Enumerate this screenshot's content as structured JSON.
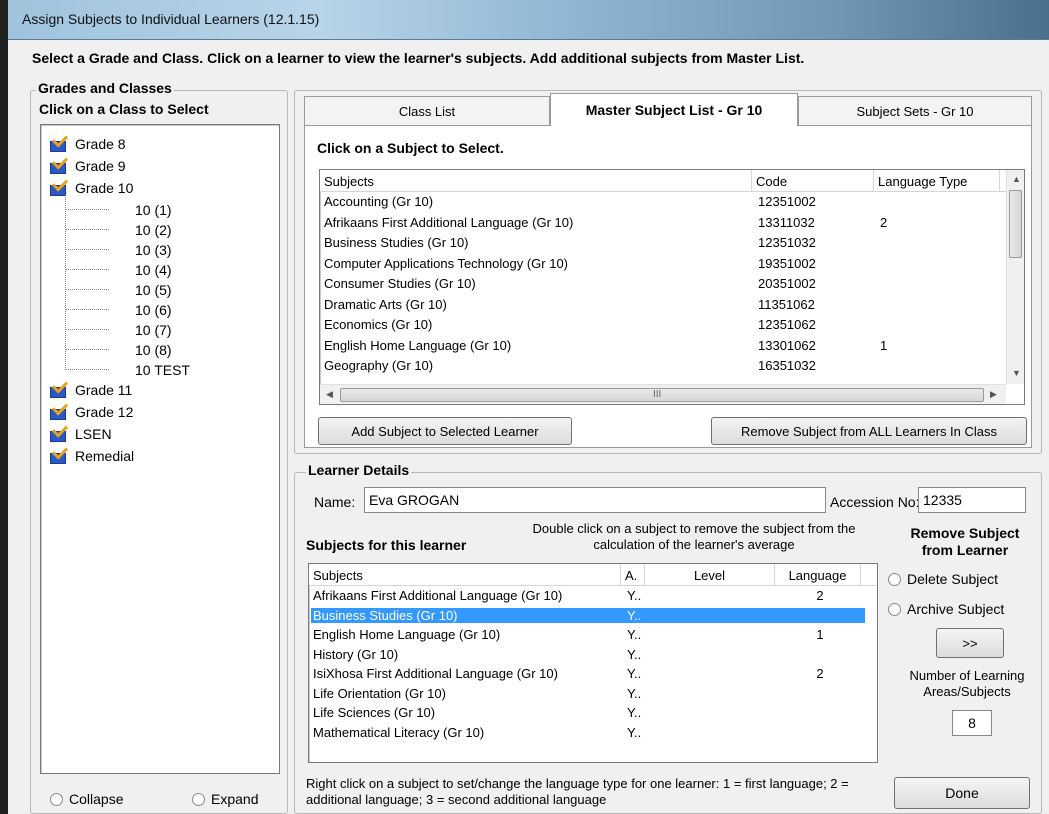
{
  "window": {
    "title": "Assign Subjects to Individual Learners (12.1.15)"
  },
  "instructions": "Select a Grade and Class. Click on a learner to view the learner's subjects. Add additional subjects from Master List.",
  "grades_panel": {
    "legend": "Grades and Classes",
    "subtitle": "Click on a Class to Select",
    "tree": [
      {
        "label": "Grade 8",
        "level": 0
      },
      {
        "label": "Grade 9",
        "level": 0
      },
      {
        "label": "Grade 10",
        "level": 0
      },
      {
        "label": "10 (1)",
        "level": 1
      },
      {
        "label": "10 (2)",
        "level": 1
      },
      {
        "label": "10 (3)",
        "level": 1
      },
      {
        "label": "10 (4)",
        "level": 1
      },
      {
        "label": "10 (5)",
        "level": 1
      },
      {
        "label": "10 (6)",
        "level": 1
      },
      {
        "label": "10 (7)",
        "level": 1
      },
      {
        "label": "10 (8)",
        "level": 1
      },
      {
        "label": "10 TEST",
        "level": 1
      },
      {
        "label": "Grade 11",
        "level": 0
      },
      {
        "label": "Grade 12",
        "level": 0
      },
      {
        "label": "LSEN",
        "level": 0
      },
      {
        "label": "Remedial",
        "level": 0
      }
    ],
    "collapse_label": "Collapse",
    "expand_label": "Expand"
  },
  "tabs": [
    {
      "label": "Class List",
      "active": false
    },
    {
      "label": "Master Subject List - Gr 10",
      "active": true
    },
    {
      "label": "Subject Sets - Gr 10",
      "active": false
    }
  ],
  "master_list": {
    "prompt": "Click on a Subject to Select.",
    "columns": [
      "Subjects",
      "Code",
      "Language Type"
    ],
    "rows": [
      [
        "Accounting (Gr 10)",
        "12351002",
        ""
      ],
      [
        "Afrikaans First Additional Language (Gr 10)",
        "13311032",
        "2"
      ],
      [
        "Business Studies (Gr 10)",
        "12351032",
        ""
      ],
      [
        "Computer Applications Technology (Gr 10)",
        "19351002",
        ""
      ],
      [
        "Consumer Studies (Gr 10)",
        "20351002",
        ""
      ],
      [
        "Dramatic Arts (Gr 10)",
        "11351062",
        ""
      ],
      [
        "Economics (Gr 10)",
        "12351062",
        ""
      ],
      [
        "English Home Language (Gr 10)",
        "13301062",
        "1"
      ],
      [
        "Geography (Gr 10)",
        "16351032",
        ""
      ]
    ],
    "hscroll_grip": "III",
    "add_button": "Add Subject to Selected Learner",
    "remove_all_button": "Remove Subject from ALL Learners In Class"
  },
  "learner": {
    "legend": "Learner Details",
    "name_label": "Name:",
    "name_value": "Eva GROGAN",
    "accession_label": "Accession No:",
    "accession_value": "12335",
    "subjects_heading": "Subjects for this learner",
    "double_click_note": "Double click on a subject to remove the subject from the calculation of the learner's average",
    "columns": [
      "Subjects",
      "A.",
      "Level",
      "Language"
    ],
    "rows": [
      [
        "Afrikaans First Additional Language (Gr 10)",
        "Y..",
        "",
        "2"
      ],
      [
        "Business Studies (Gr 10)",
        "Y..",
        "",
        ""
      ],
      [
        "English Home Language (Gr 10)",
        "Y..",
        "",
        "1"
      ],
      [
        "History (Gr 10)",
        "Y..",
        "",
        ""
      ],
      [
        "IsiXhosa First Additional Language (Gr 10)",
        "Y..",
        "",
        "2"
      ],
      [
        "Life Orientation (Gr 10)",
        "Y..",
        "",
        ""
      ],
      [
        "Life Sciences (Gr 10)",
        "Y..",
        "",
        ""
      ],
      [
        "Mathematical Literacy (Gr 10)",
        "Y..",
        "",
        ""
      ]
    ],
    "selected_row": 1,
    "footnote": "Right click on a subject to set/change the language type for one learner: 1 = first language; 2 = additional language; 3 = second additional language"
  },
  "remove_panel": {
    "heading": "Remove Subject from Learner",
    "delete_label": "Delete Subject",
    "archive_label": "Archive Subject",
    "go_button": ">>",
    "count_label": "Number of Learning Areas/Subjects",
    "count_value": "8"
  },
  "done_button": "Done",
  "colors": {
    "selection": "#3399ff",
    "title_gradient_start": "#9fc3de"
  }
}
